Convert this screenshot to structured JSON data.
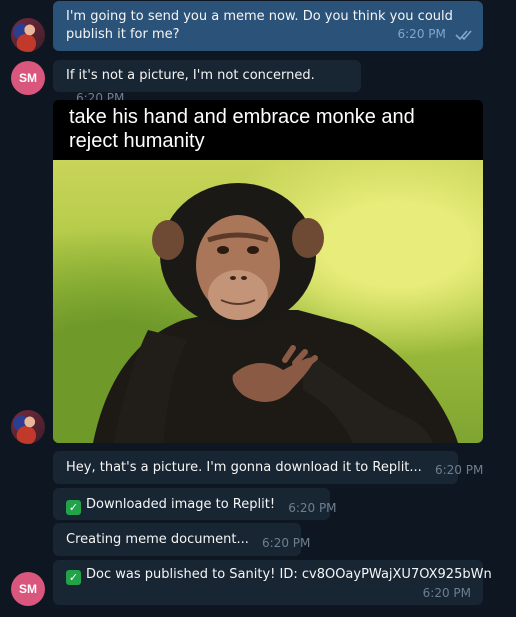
{
  "messages": [
    {
      "text": "I'm going to send you a meme now. Do you think you could publish it for me?",
      "time": "6:20 PM",
      "sender": "photo",
      "status": "read"
    },
    {
      "text": "If it's not a picture, I'm not concerned.",
      "time": "6:20 PM",
      "sender": "SM"
    },
    {
      "caption": "take his hand and embrace monke and reject humanity",
      "sender": "photo",
      "image": "chimpanzee-meme"
    },
    {
      "text": "Hey, that's a picture. I'm gonna download it to Replit...",
      "time": "6:20 PM"
    },
    {
      "text": "Downloaded image to Replit!",
      "time": "6:20 PM",
      "icon": "check-mark-icon"
    },
    {
      "text": "Creating meme document...",
      "time": "6:20 PM"
    },
    {
      "text": "Doc was published to Sanity! ID: cv8OOayPWajXU7OX925bWn",
      "time": "6:20 PM",
      "icon": "check-mark-icon",
      "sender": "SM"
    }
  ],
  "avatar_initials": "SM",
  "colors": {
    "background": "#0e1621",
    "outgoing": "#2b5278",
    "incoming": "#182533",
    "avatar": "#d9567d"
  }
}
